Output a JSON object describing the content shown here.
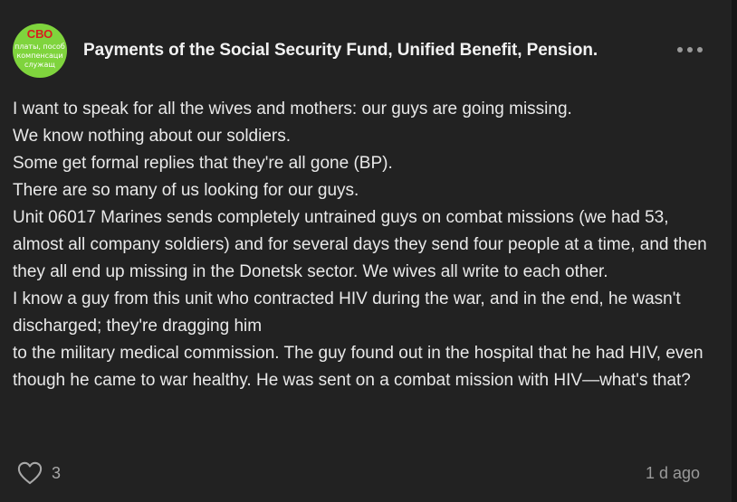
{
  "avatar": {
    "title": "СВО",
    "line1": "платы, пособ",
    "line2": "компенсаци",
    "line3": "служащ",
    "bg_color": "#7fd43d",
    "title_color": "#d81e1e"
  },
  "channel": {
    "title": "Payments of the Social Security Fund, Unified Benefit, Pension.",
    "more_icon": "more-horizontal-icon"
  },
  "post": {
    "lines": [
      "I want to speak for all the wives and mothers: our guys are going missing.",
      "We know nothing about our soldiers.",
      "Some get formal replies that they're all gone (BP).",
      "There are so many of us looking for our guys.",
      "Unit 06017 Marines sends completely untrained guys on combat missions (we had 53, almost all company soldiers) and for several days they send four people at a time, and then they all end up missing in the Donetsk sector. We wives all write to each other.",
      "I know a guy from this unit who contracted HIV during the war, and in the end, he wasn't discharged; they're dragging him",
      "to the military medical commission. The guy found out in the hospital that he had HIV, even though he came to war healthy. He was sent on a combat mission with HIV—what's that?"
    ]
  },
  "footer": {
    "like_icon": "heart-outline-icon",
    "likes": "3",
    "time": "1 d ago"
  }
}
